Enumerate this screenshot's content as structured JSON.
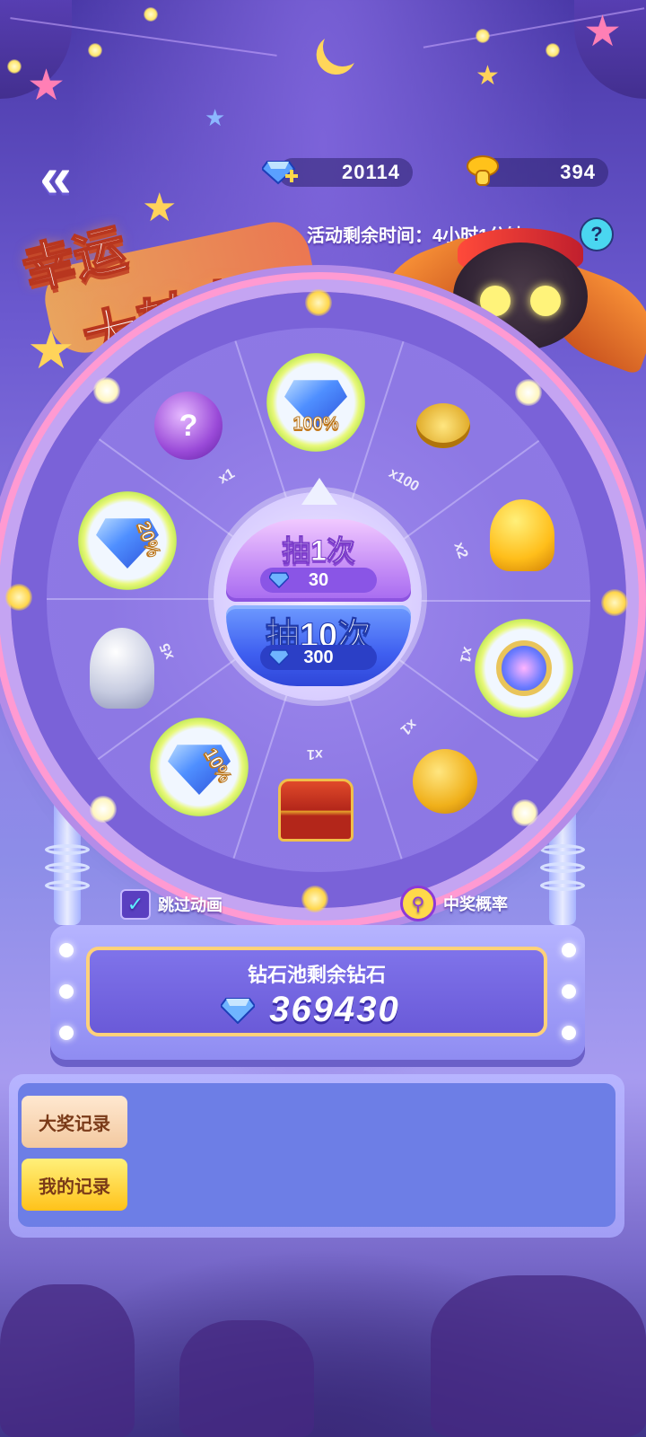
{
  "header": {
    "back_label": "«",
    "diamond_count": "20114",
    "mushroom_count": "394",
    "timer_text": "活动剩余时间：4小时1分钟",
    "help_label": "?"
  },
  "title": {
    "line1": "幸运",
    "line2": "大转盘"
  },
  "wheel": {
    "prizes": [
      {
        "tag": "100%",
        "icon": "diamond-pile-icon"
      },
      {
        "tag": "",
        "icon": "gold-coins-icon"
      },
      {
        "tag": "",
        "icon": "gold-mushroom-icon"
      },
      {
        "tag": "",
        "icon": "avatar-frame-icon"
      },
      {
        "tag": "",
        "icon": "gold-mystery-icon"
      },
      {
        "tag": "",
        "icon": "treasure-chest-icon"
      },
      {
        "tag": "10%",
        "icon": "diamond-pile-icon"
      },
      {
        "tag": "",
        "icon": "silver-mushroom-icon"
      },
      {
        "tag": "20%",
        "icon": "diamond-pile-icon"
      },
      {
        "tag": "",
        "icon": "purple-mystery-icon"
      }
    ],
    "multipliers": [
      "x1",
      "x100",
      "x2",
      "x1",
      "x1",
      "x1",
      "x5"
    ],
    "spin_once_label": "抽1次",
    "spin_once_cost": "30",
    "spin_ten_label": "抽10次",
    "spin_ten_cost": "300"
  },
  "options": {
    "skip_animation_label": "跳过动画",
    "skip_animation_checked": true,
    "odds_label": "中奖概率"
  },
  "pool": {
    "label": "钻石池剩余钻石",
    "value": "369430"
  },
  "records": {
    "grand_prize_label": "大奖记录",
    "my_records_label": "我的记录"
  },
  "colors": {
    "accent_gold": "#ffd17a",
    "primary_blue": "#3f5ff0",
    "primary_purple": "#a66af0"
  }
}
